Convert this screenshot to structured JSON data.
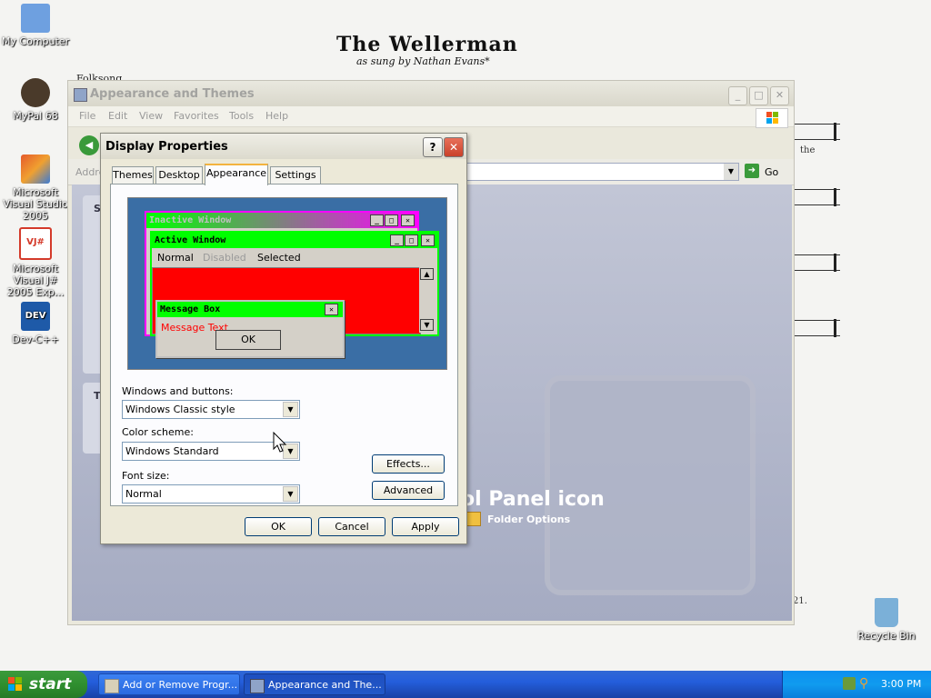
{
  "wallpaper": {
    "title": "The Wellerman",
    "subtitle": "as sung by Nathan Evans*",
    "left_text": "Folksong",
    "right_texts": [
      "the",
      "21."
    ]
  },
  "desktop_icons": [
    {
      "label": "My Computer",
      "color": "#6ea0e0"
    },
    {
      "label": "MyPal 68",
      "color": "#4a3a2a"
    },
    {
      "label": "Microsoft Visual Studio 2005",
      "color": "#e55a2b"
    },
    {
      "label": "Microsoft Visual J# 2005 Exp...",
      "color": "#d43a2a"
    },
    {
      "label": "Dev-C++",
      "color": "#1e5aa8"
    },
    {
      "label": "Recycle Bin",
      "color": "#7bb0d8"
    }
  ],
  "explorer": {
    "title": "Appearance and Themes",
    "menu": [
      "File",
      "Edit",
      "View",
      "Favorites",
      "Tools",
      "Help"
    ],
    "address_label": "Addre",
    "go_label": "Go",
    "heading": "ol Panel icon",
    "folder_options": "Folder Options",
    "side_headings": [
      "S",
      "T"
    ]
  },
  "dialog": {
    "title": "Display Properties",
    "help_glyph": "?",
    "close_glyph": "✕",
    "tabs": [
      "Themes",
      "Desktop",
      "Appearance",
      "Settings"
    ],
    "active_tab": "Appearance",
    "preview": {
      "inactive_title": "Inactive Window",
      "active_title": "Active Window",
      "menu_normal": "Normal",
      "menu_disabled": "Disabled",
      "menu_selected": "Selected",
      "msgbox_title": "Message Box",
      "msgbox_text": "Message Text",
      "msgbox_ok": "OK"
    },
    "windows_buttons_label": "Windows and buttons:",
    "windows_buttons_value": "Windows Classic style",
    "color_scheme_label": "Color scheme:",
    "color_scheme_value": "Windows Standard",
    "font_size_label": "Font size:",
    "font_size_value": "Normal",
    "effects_label": "Effects...",
    "advanced_label": "Advanced",
    "ok_label": "OK",
    "cancel_label": "Cancel",
    "apply_label": "Apply"
  },
  "taskbar": {
    "start_label": "start",
    "tasks": [
      "Add or Remove Progr...",
      "Appearance and The..."
    ],
    "time": "3:00 PM"
  },
  "colors": {
    "preview_bg": "#3a6ea5",
    "active_bar": "#00ff00",
    "inactive_bar_start": "#00ff00",
    "inactive_bar_end": "#ff00ff",
    "window_fill": "#ff0000"
  }
}
